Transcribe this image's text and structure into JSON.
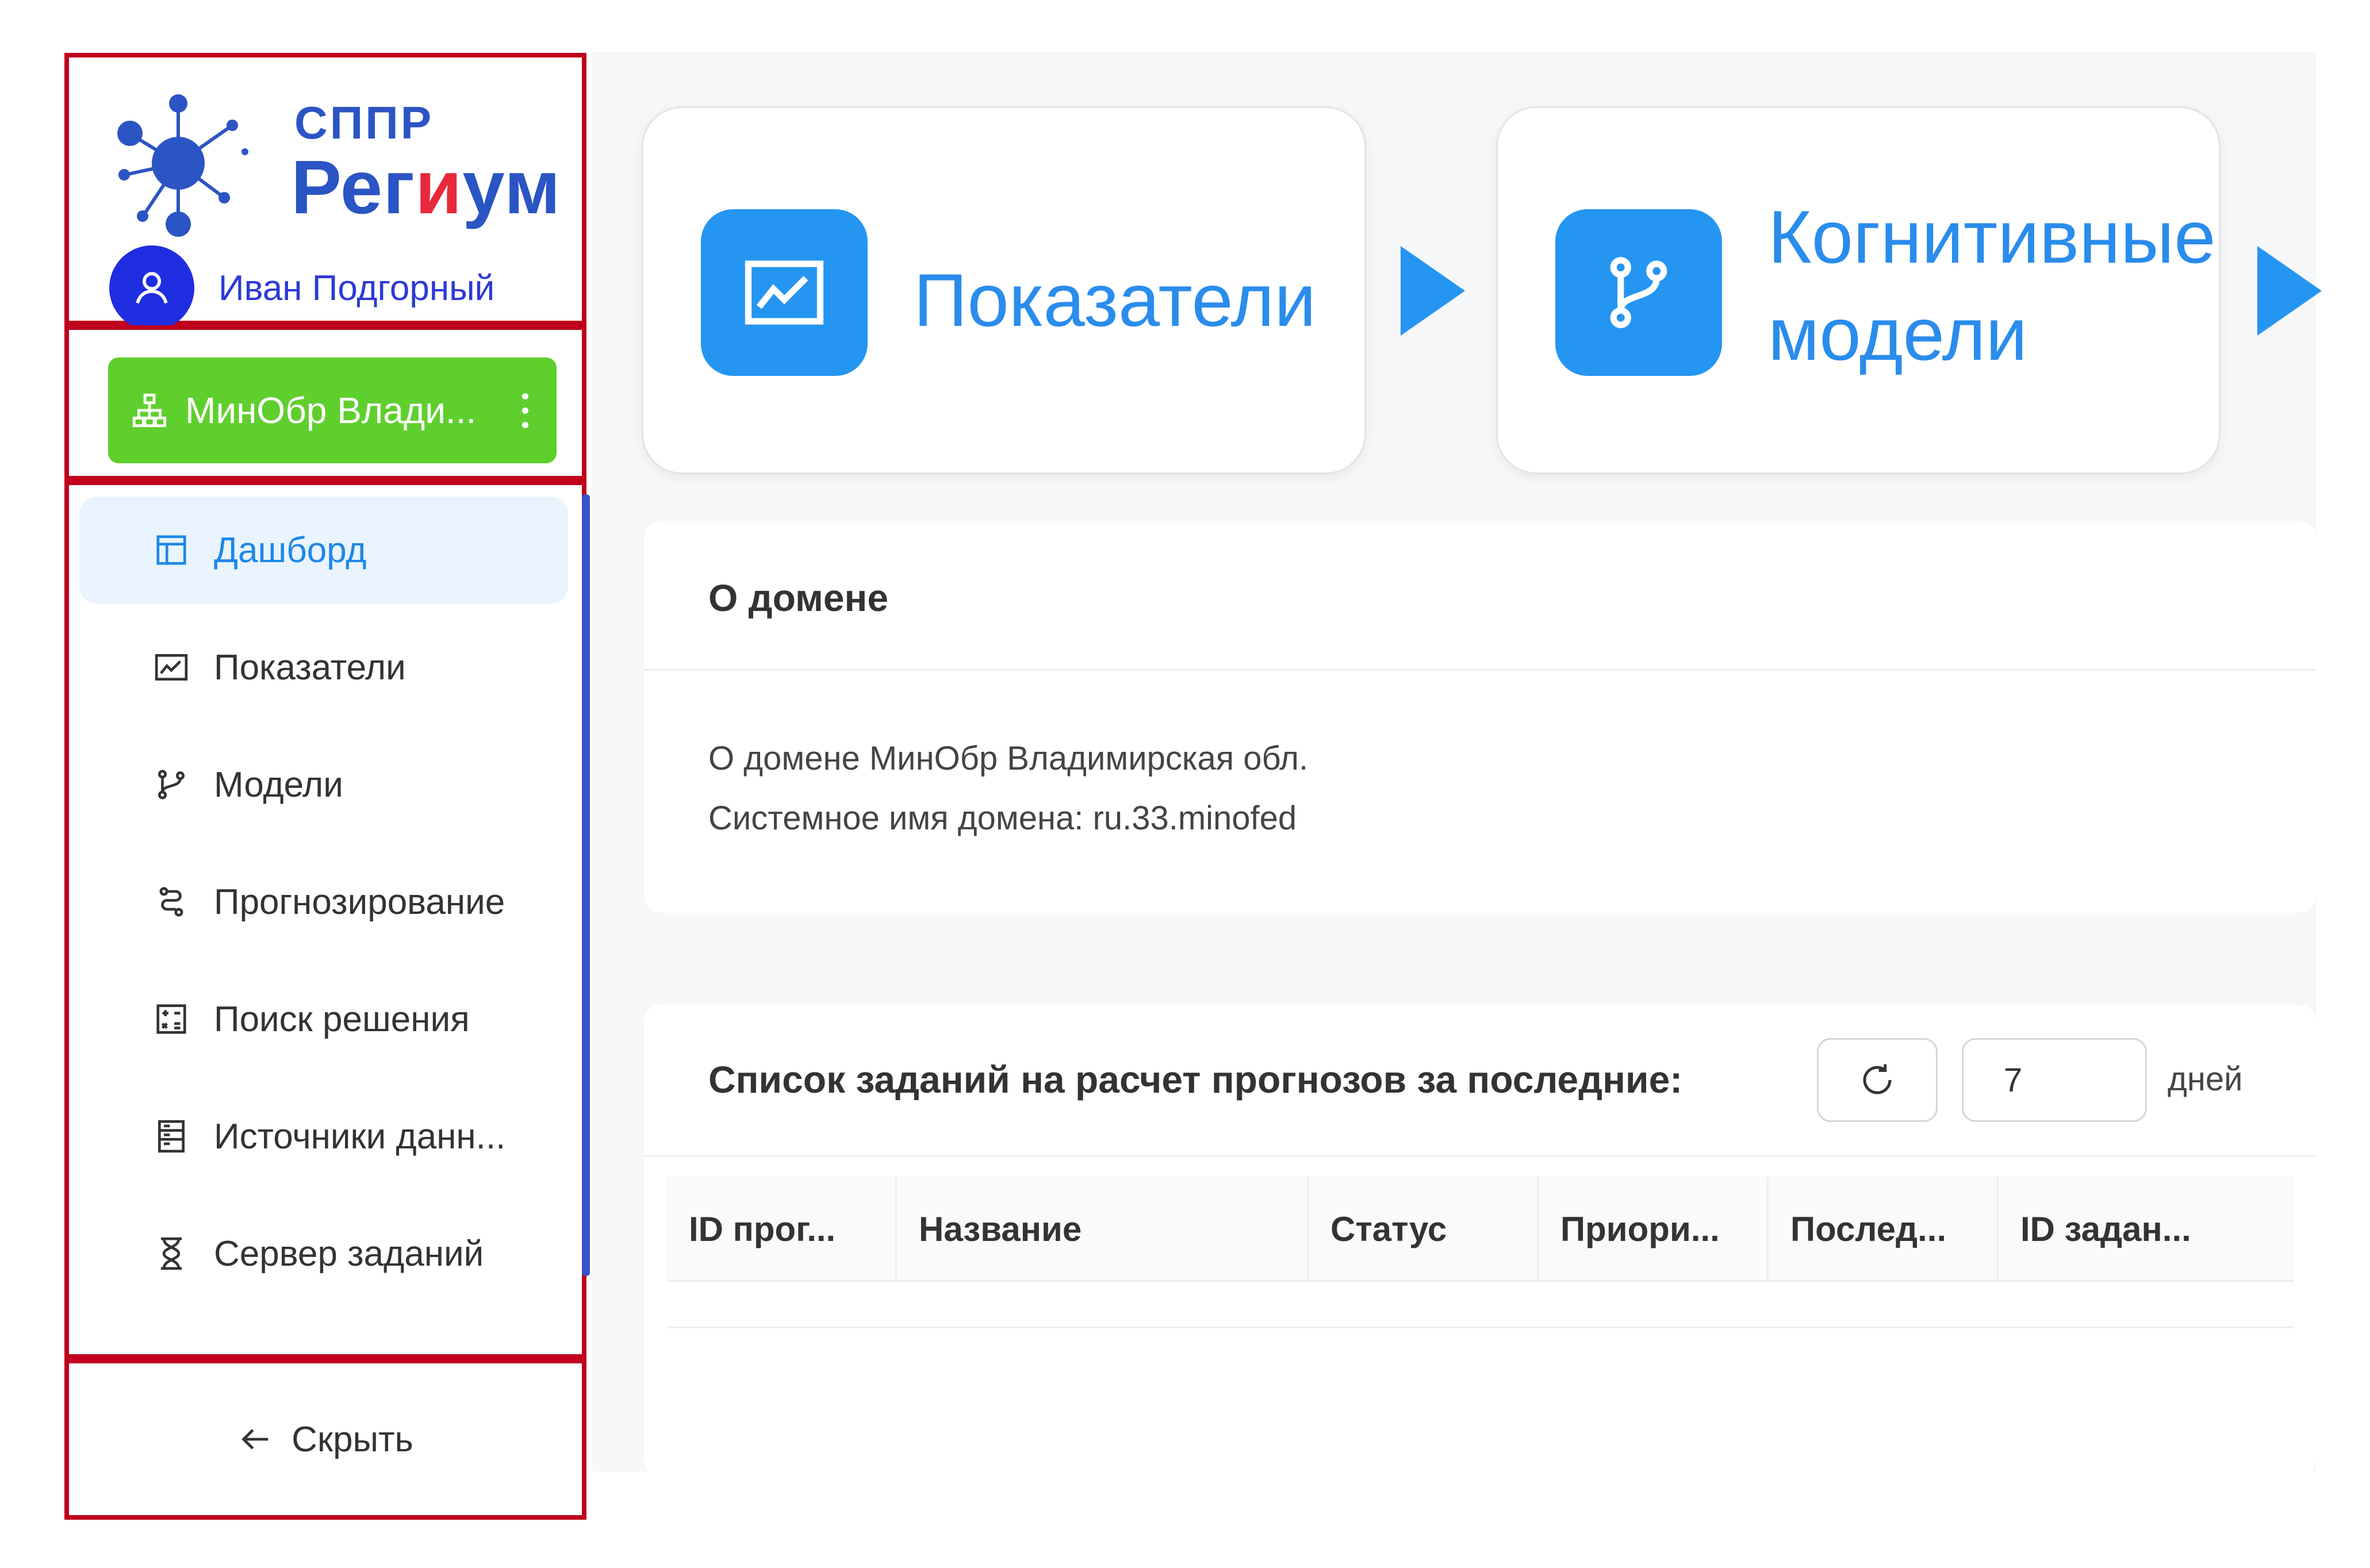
{
  "app": {
    "logo_sub": "СППР",
    "logo_main_a": "Рег",
    "logo_main_b": "и",
    "logo_main_c": "ум",
    "user_name": "Иван Подгорный"
  },
  "domain_selector": {
    "label": "МинОбр Влади..."
  },
  "sidebar": {
    "items": [
      {
        "label": "Дашборд",
        "icon": "layout-icon",
        "active": true
      },
      {
        "label": "Показатели",
        "icon": "line-chart-icon"
      },
      {
        "label": "Модели",
        "icon": "branch-icon"
      },
      {
        "label": "Прогнозирование",
        "icon": "forecast-icon"
      },
      {
        "label": "Поиск решения",
        "icon": "calculator-icon"
      },
      {
        "label": "Источники данн...",
        "icon": "database-icon"
      },
      {
        "label": "Сервер заданий",
        "icon": "hourglass-icon"
      }
    ],
    "hide_label": "Скрыть"
  },
  "workflow": {
    "cards": [
      {
        "label": "Показатели",
        "icon": "line-chart-icon"
      },
      {
        "line1": "Когнитивные",
        "line2": "модели",
        "icon": "branch-icon"
      }
    ]
  },
  "about": {
    "title": "О домене",
    "line1": "О домене МинОбр Владимирская обл.",
    "line2": "Системное имя домена: ru.33.minofed"
  },
  "tasks": {
    "title": "Список заданий на расчет прогнозов за последние:",
    "days_value": "7",
    "days_label": "дней",
    "columns": [
      "ID прог...",
      "Название",
      "Статус",
      "Приори...",
      "Послед...",
      "ID задан..."
    ]
  },
  "colors": {
    "accent": "#2595f2",
    "domain_green": "#5fcf2e",
    "highlight_border": "#c0001d",
    "user_blue": "#1f2de0"
  }
}
